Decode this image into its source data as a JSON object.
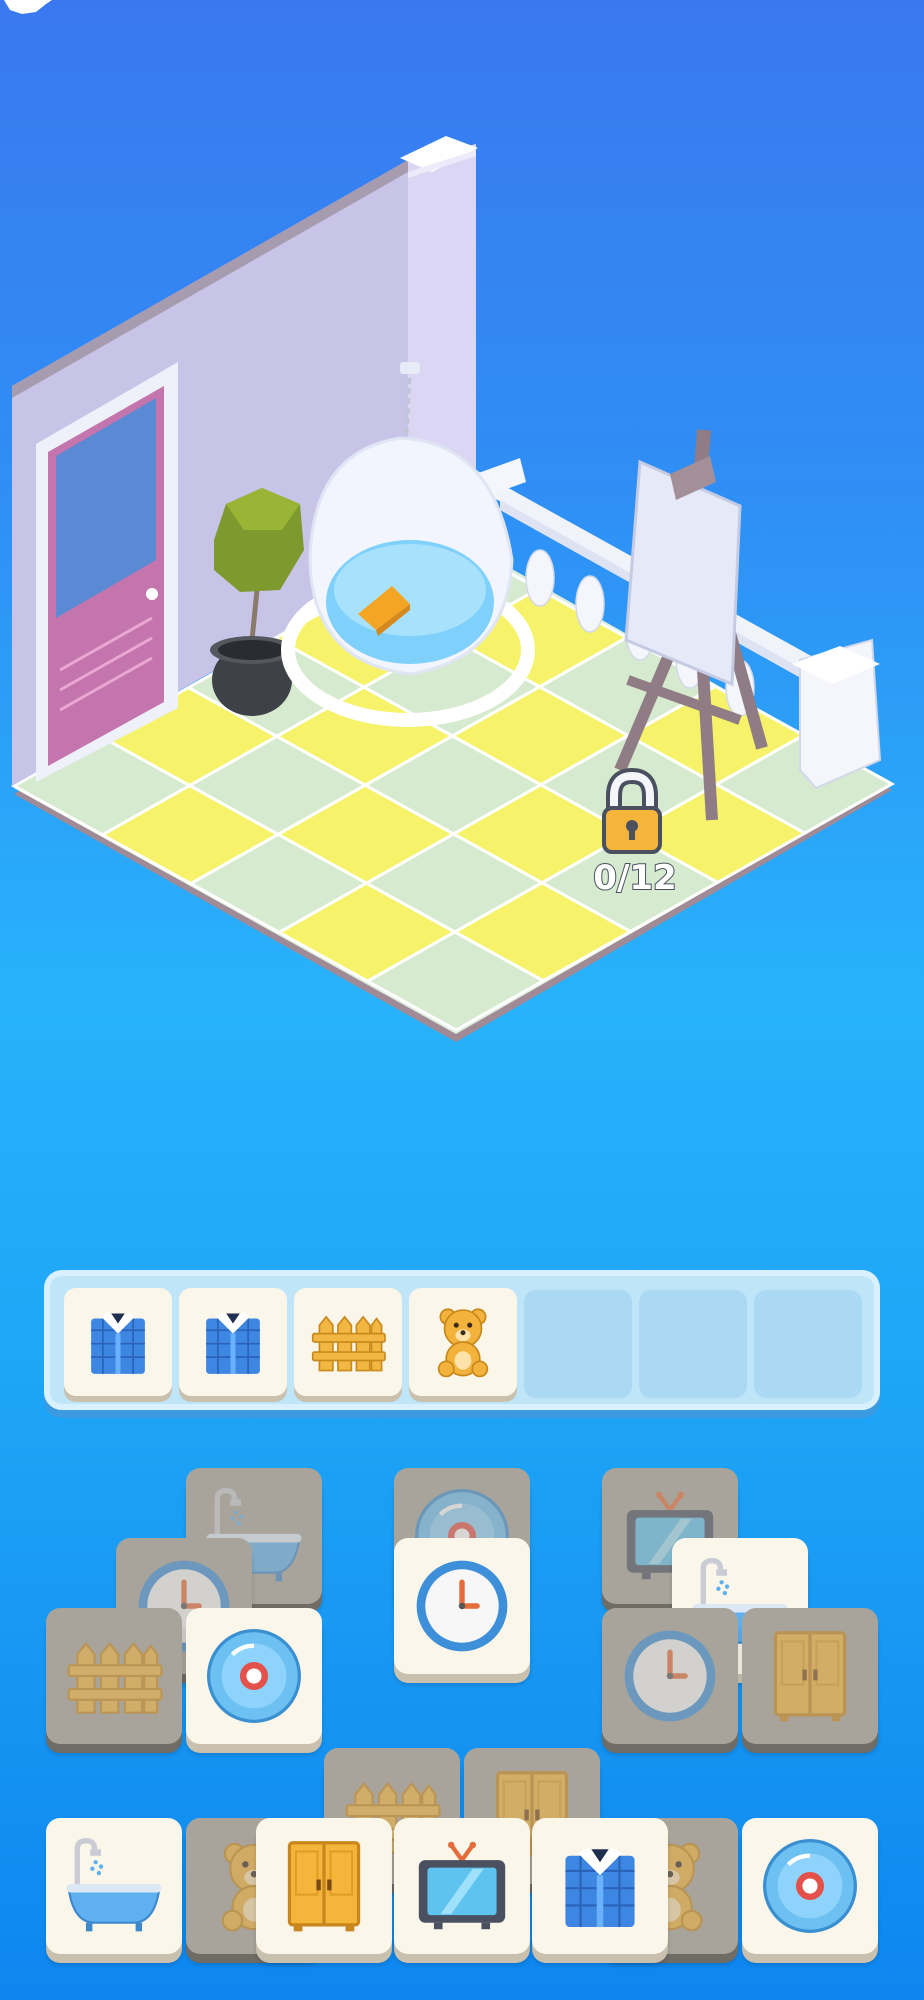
{
  "level": {
    "lock_progress": "0/12"
  },
  "tray": {
    "capacity": 7,
    "items": [
      {
        "icon": "shirt-icon"
      },
      {
        "icon": "shirt-icon"
      },
      {
        "icon": "fence-icon"
      },
      {
        "icon": "teddy-bear-icon"
      }
    ]
  },
  "colors": {
    "tile_face": "#fbf6ea",
    "tile_blocked": "#a8a49c",
    "tray_bg": "#bfe5f8",
    "floor_yellow": "#f6f36a",
    "floor_green": "#d6ead0",
    "door_pink": "#c575ad",
    "lock_gold": "#f5b53a"
  },
  "board": {
    "tiles": [
      {
        "icon": "bathtub-icon",
        "state": "blocked"
      },
      {
        "icon": "cd-icon",
        "state": "blocked"
      },
      {
        "icon": "tv-icon",
        "state": "blocked"
      },
      {
        "icon": "clock-icon",
        "state": "blocked"
      },
      {
        "icon": "clock-icon",
        "state": "active"
      },
      {
        "icon": "bathtub-icon",
        "state": "active"
      },
      {
        "icon": "fence-icon",
        "state": "blocked"
      },
      {
        "icon": "cd-icon",
        "state": "active"
      },
      {
        "icon": "clock-icon",
        "state": "blocked"
      },
      {
        "icon": "wardrobe-icon",
        "state": "blocked"
      },
      {
        "icon": "fence-icon",
        "state": "blocked"
      },
      {
        "icon": "wardrobe-icon",
        "state": "blocked"
      },
      {
        "icon": "teddy-bear-icon",
        "state": "blocked"
      },
      {
        "icon": "teddy-bear-icon",
        "state": "blocked"
      },
      {
        "icon": "bathtub-icon",
        "state": "active"
      },
      {
        "icon": "wardrobe-icon",
        "state": "active"
      },
      {
        "icon": "tv-icon",
        "state": "active"
      },
      {
        "icon": "shirt-icon",
        "state": "active"
      },
      {
        "icon": "cd-icon",
        "state": "active"
      }
    ]
  }
}
